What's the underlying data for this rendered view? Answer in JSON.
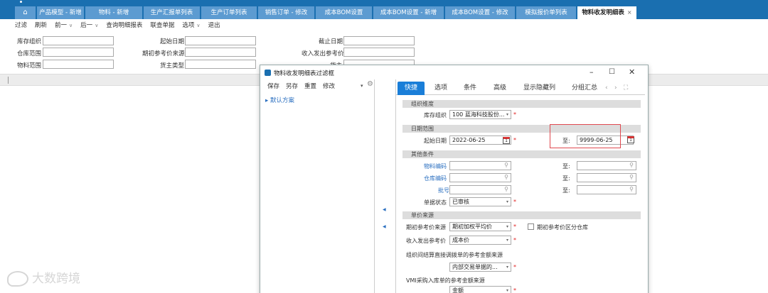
{
  "tabbar": {
    "tabs": [
      {
        "label": "产品模型 - 新增",
        "active": false
      },
      {
        "label": "物料 - 新增",
        "active": false
      },
      {
        "label": "生产汇报单列表",
        "active": false
      },
      {
        "label": "生产订单列表",
        "active": false
      },
      {
        "label": "销售订单 - 修改",
        "active": false
      },
      {
        "label": "成本BOM设置",
        "active": false
      },
      {
        "label": "成本BOM设置 - 新增",
        "active": false
      },
      {
        "label": "成本BOM设置 - 修改",
        "active": false
      },
      {
        "label": "模拟报价单列表",
        "active": false
      },
      {
        "label": "物料收发明细表",
        "active": true
      }
    ],
    "close_glyph": "×"
  },
  "toolbar": {
    "items": [
      "过滤",
      "刷新",
      "前一",
      "后一",
      "查询明细报表",
      "联查单据",
      "选项",
      "退出"
    ]
  },
  "filter": {
    "stock_org": "库存组织",
    "warehouse_range": "仓库范围",
    "material_range": "物料范围",
    "start_date": "起始日期",
    "initial_ref_source": "期初参考价来源",
    "owner_type": "货主类型",
    "end_date": "截止日期",
    "io_ref_price": "收入发出参考价",
    "owner": "货主"
  },
  "dialog": {
    "title": "物料收发明细表过滤框",
    "buttons": {
      "save": "保存",
      "save_as": "另存",
      "reset": "重置",
      "modify": "修改"
    },
    "scheme": "默认方案",
    "tabs": [
      "快捷",
      "选项",
      "条件",
      "高级",
      "显示隐藏列",
      "分组汇总"
    ],
    "sections": {
      "org": "组织维度",
      "date": "日期范围",
      "other": "其他条件",
      "price": "单价来源"
    },
    "fields": {
      "stock_org_label": "库存组织",
      "stock_org_value": "100 蓝海科技股份...",
      "start_date_label": "起始日期",
      "start_date_value": "2022-06-25",
      "to_label": "至:",
      "end_date_value": "9999-06-25",
      "material_code_label": "物料编码",
      "warehouse_code_label": "仓库编码",
      "batch_label": "批号",
      "status_label": "单据状态",
      "status_value": "已审核",
      "initial_ref_label": "期初参考价来源",
      "initial_ref_value": "期初加权平均价",
      "split_warehouse_label": "期初参考价区分仓库",
      "io_ref_label": "收入发出参考价",
      "io_ref_value": "成本价",
      "cross_org_label": "组织间结算直接调拨单的参考金额来源",
      "cross_org_value": "内部交易单据的...",
      "vmi_label": "VMI采购入库单的参考金额来源",
      "vmi_value": "金额",
      "calendar_glyph": "1",
      "required_mark": "*"
    }
  },
  "watermark": "大数跨境"
}
